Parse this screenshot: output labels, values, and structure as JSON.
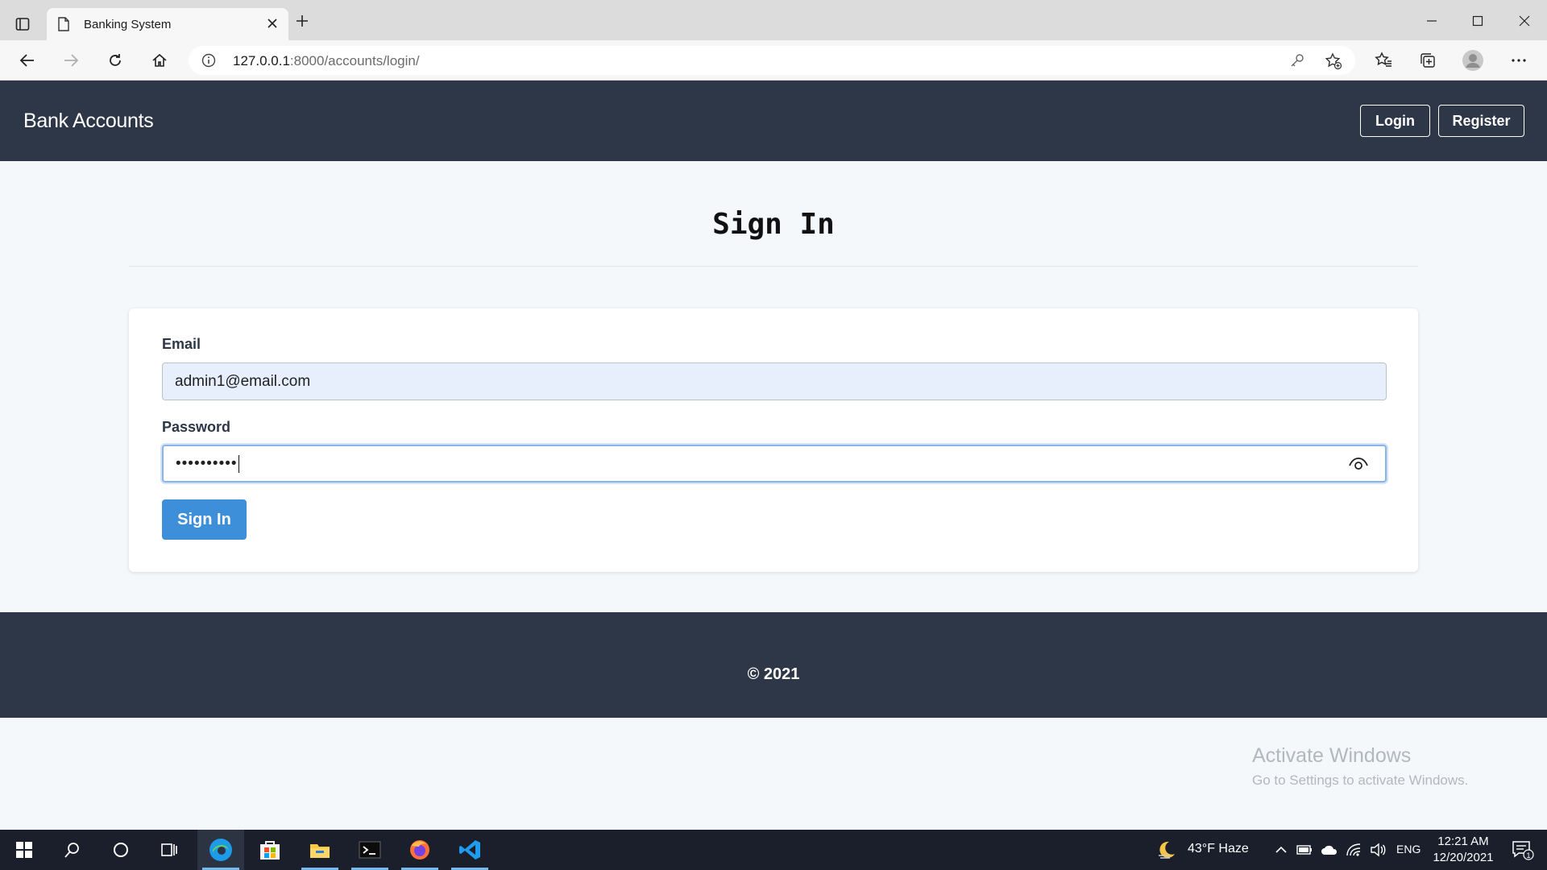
{
  "browser": {
    "tab_title": "Banking System",
    "url_host": "127.0.0.1",
    "url_rest": ":8000/accounts/login/"
  },
  "navbar": {
    "brand": "Bank Accounts",
    "login_label": "Login",
    "register_label": "Register"
  },
  "page": {
    "heading": "Sign In"
  },
  "form": {
    "email_label": "Email",
    "email_value": "admin1@email.com",
    "password_label": "Password",
    "password_mask": "••••••••••",
    "submit_label": "Sign In"
  },
  "footer": {
    "copyright": "© 2021"
  },
  "watermark": {
    "line1": "Activate Windows",
    "line2": "Go to Settings to activate Windows."
  },
  "taskbar": {
    "weather": "43°F  Haze",
    "language": "ENG",
    "time": "12:21 AM",
    "date": "12/20/2021",
    "notification_count": "1"
  },
  "colors": {
    "navbar_bg": "#2d3748",
    "primary_button": "#3d8fd9",
    "page_bg": "#f5f8fb"
  }
}
